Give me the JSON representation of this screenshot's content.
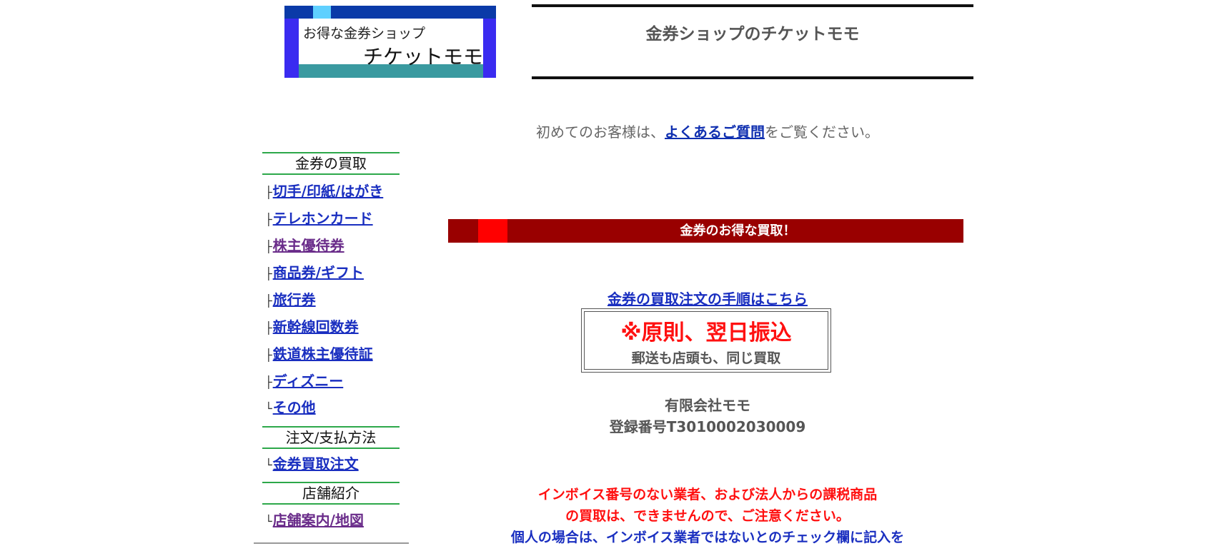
{
  "logo": {
    "small_text": "お得な金券ショップ",
    "big_text": "チケットモモ",
    "colors": {
      "frame": "#3a2bf0",
      "top_bar": "#0a3aa8",
      "accent": "#5fd0ff",
      "bottom_bar": "#3a9aa0"
    }
  },
  "header": {
    "title": "金券ショップのチケットモモ"
  },
  "intro": {
    "prefix": "初めてのお客様は、",
    "link": "よくあるご質問",
    "suffix": "をご覧ください。"
  },
  "sidebar": {
    "sections": [
      {
        "heading": "金券の買取"
      },
      {
        "heading": "注文/支払方法"
      },
      {
        "heading": "店舗紹介"
      }
    ],
    "items": [
      {
        "branch": "├",
        "label": "切手/印紙/はがき"
      },
      {
        "branch": "├",
        "label": "テレホンカード"
      },
      {
        "branch": "├",
        "label": "株主優待券"
      },
      {
        "branch": "├",
        "label": "商品券/ギフト"
      },
      {
        "branch": "├",
        "label": "旅行券"
      },
      {
        "branch": "├",
        "label": "新幹線回数券"
      },
      {
        "branch": "├",
        "label": "鉄道株主優待証"
      },
      {
        "branch": "├",
        "label": "ディズニー"
      },
      {
        "branch": "└",
        "label": "その他"
      },
      {
        "branch": "└",
        "label": "金券買取注文"
      },
      {
        "branch": "└",
        "label": "店舗案内/地図"
      }
    ]
  },
  "banner": {
    "text": "金券のお得な買取！",
    "colors": {
      "background": "#990000",
      "accent": "#ff0000"
    }
  },
  "main": {
    "order_link": "金券の買取注文の手順はこちら",
    "box_headline": "※原則、翌日振込",
    "box_sub": "郵送も店頭も、同じ買取",
    "company_name": "有限会社モモ",
    "registration": "登録番号T3010002030009",
    "notice_red_1": "インボイス番号のない業者、および法人からの課税商品",
    "notice_red_2": "の買取は、できませんので、ご注意ください。",
    "notice_blue_1": "個人の場合は、インボイス業者ではないとのチェック欄に記入を"
  }
}
